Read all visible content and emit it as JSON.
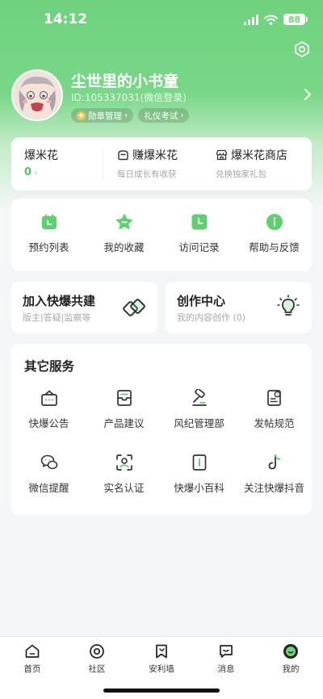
{
  "status_bar": {
    "time": "14:12",
    "battery": "88"
  },
  "profile": {
    "nickname": "尘世里的小书童",
    "uid": "ID:105337031(微信登录)",
    "badges": [
      {
        "label": "勋章管理",
        "arrow": "›"
      },
      {
        "label": "礼仪考试",
        "arrow": "›"
      }
    ]
  },
  "wallet": {
    "popcorn": {
      "title": "爆米花",
      "count": "0",
      "arrow": "›"
    },
    "earn": {
      "title": "赚爆米花",
      "subtitle": "每日成长有收获"
    },
    "shop": {
      "title": "爆米花商店",
      "subtitle": "兑换独家礼包"
    }
  },
  "quick_actions": [
    {
      "label": "预约列表",
      "icon": "calendar-icon"
    },
    {
      "label": "我的收藏",
      "icon": "star-icon"
    },
    {
      "label": "访问记录",
      "icon": "clock-icon"
    },
    {
      "label": "帮助与反馈",
      "icon": "info-icon"
    }
  ],
  "cards": {
    "join": {
      "title": "加入快爆共建",
      "subtitle": "版主|答疑|监察等"
    },
    "create": {
      "title": "创作中心",
      "subtitle": "我的内容创作 (0)"
    }
  },
  "services": {
    "title": "其它服务",
    "items": [
      {
        "label": "快爆公告",
        "icon": "announcement-icon"
      },
      {
        "label": "产品建议",
        "icon": "suggestion-icon"
      },
      {
        "label": "风纪管理部",
        "icon": "gavel-icon"
      },
      {
        "label": "发帖规范",
        "icon": "rules-icon"
      },
      {
        "label": "微信提醒",
        "icon": "wechat-icon"
      },
      {
        "label": "实名认证",
        "icon": "face-scan-icon"
      },
      {
        "label": "快爆小百科",
        "icon": "book-icon"
      },
      {
        "label": "关注快爆抖音",
        "icon": "tiktok-icon"
      }
    ]
  },
  "tabbar": [
    {
      "label": "首页",
      "icon": "home-icon"
    },
    {
      "label": "社区",
      "icon": "community-icon"
    },
    {
      "label": "安利墙",
      "icon": "bookmark-icon"
    },
    {
      "label": "消息",
      "icon": "message-icon"
    },
    {
      "label": "我的",
      "icon": "profile-icon"
    }
  ],
  "colors": {
    "brand": "#6fd27d",
    "accent": "#4fc35f"
  }
}
